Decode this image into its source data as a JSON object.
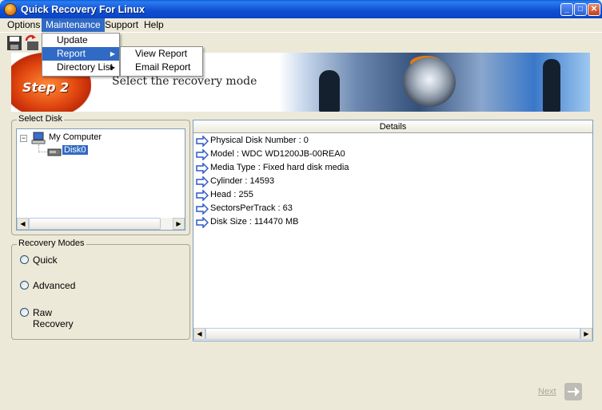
{
  "window": {
    "title": "Quick Recovery For Linux"
  },
  "menu": [
    "Options",
    "Maintenance",
    "Support",
    "Help"
  ],
  "maintenance_menu": {
    "items": [
      "Update",
      "Report",
      "Directory List"
    ],
    "report_submenu": [
      "View Report",
      "Email Report"
    ]
  },
  "banner": {
    "step": "Step 2",
    "subtitle": "Select the recovery mode"
  },
  "select_disk": {
    "group_label": "Select Disk",
    "tree": {
      "root": "My Computer",
      "child": "Disk0"
    }
  },
  "recovery_modes": {
    "group_label": "Recovery Modes",
    "options": [
      "Quick",
      "Advanced",
      "Raw Recovery"
    ]
  },
  "details": {
    "header": "Details",
    "rows": [
      "Physical Disk Number : 0",
      "Model   : WDC WD1200JB-00REA0",
      "Media Type   : Fixed hard disk media",
      "Cylinder   : 14593",
      "Head   : 255",
      "SectorsPerTrack   : 63",
      "Disk Size  : 114470 MB"
    ]
  },
  "footer": {
    "next_label": "Next"
  },
  "colors": {
    "title_bar": "#0a4fd2",
    "selection": "#316ac5",
    "window_bg": "#ece9d8",
    "arrow_icon": "#2f58c8"
  }
}
